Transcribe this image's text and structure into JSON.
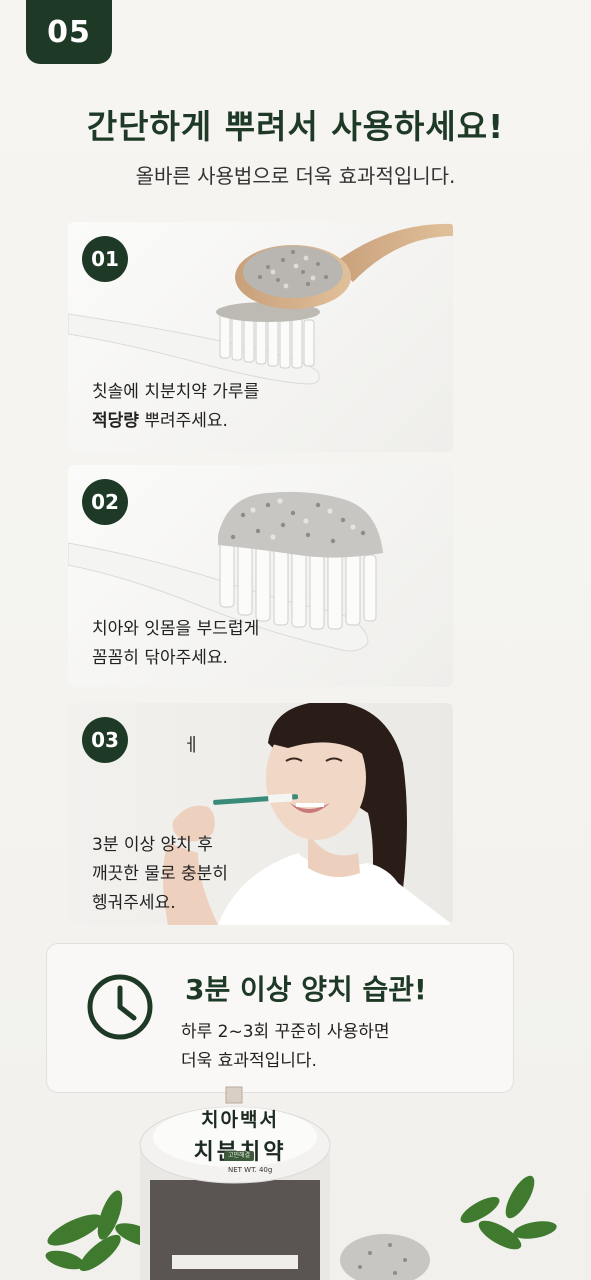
{
  "step_number": "05",
  "title": "간단하게 뿌려서 사용하세요!",
  "subtitle": "올바른 사용법으로 더욱 효과적입니다.",
  "steps": [
    {
      "num": "01",
      "line1": "칫솔에 치분치약 가루를",
      "line2_bold": "적당량",
      "line2_rest": " 뿌려주세요."
    },
    {
      "num": "02",
      "line1": "치아와 잇몸을 부드럽게",
      "line2": "꼼꼼히 닦아주세요."
    },
    {
      "num": "03",
      "stray": "ㅔ",
      "line1": "3분 이상 양치 후",
      "line2": "깨끗한 물로 충분히",
      "line3": "헹궈주세요."
    }
  ],
  "tip": {
    "icon": "clock-icon",
    "heading": "3분 이상 양치 습관!",
    "line1": "하루 2~3회 꾸준히 사용하면",
    "line2": "더욱 효과적입니다."
  },
  "product": {
    "label_line1": "치아백서",
    "label_line2": "치분치약",
    "tag": "고민해결",
    "net_weight": "NET WT. 40g"
  },
  "colors": {
    "brand": "#1e3a26",
    "background": "#f6f5f1"
  }
}
